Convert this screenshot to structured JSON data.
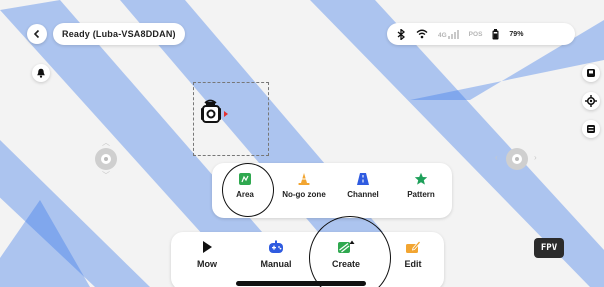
{
  "header": {
    "back_icon": "chevron-left-icon",
    "status": "Ready  (Luba-VSA8DDAN)"
  },
  "connection": {
    "bluetooth_icon": "bluetooth-icon",
    "wifi_icon": "wifi-icon",
    "cellular_label": "4G",
    "rtk_label": "POS",
    "battery_icon": "battery-icon",
    "battery": "79%"
  },
  "left_controls": {
    "alert_icon": "bell-icon"
  },
  "right_controls": {
    "icons": [
      "map-layers-icon",
      "locate-icon",
      "task-list-icon"
    ]
  },
  "create_menu": {
    "items": [
      {
        "label": "Area",
        "icon": "area-icon",
        "color": "#2fa84f"
      },
      {
        "label": "No-go zone",
        "icon": "traffic-cone-icon",
        "color": "#f2a531"
      },
      {
        "label": "Channel",
        "icon": "channel-road-icon",
        "color": "#2f5be0"
      },
      {
        "label": "Pattern",
        "icon": "star-icon",
        "color": "#1ea05a"
      }
    ]
  },
  "bottom_nav": {
    "items": [
      {
        "label": "Mow",
        "icon": "play-icon",
        "color": "#111111"
      },
      {
        "label": "Manual",
        "icon": "gamepad-icon",
        "color": "#2f5be0"
      },
      {
        "label": "Create",
        "icon": "create-map-icon",
        "color": "#2fa84f"
      },
      {
        "label": "Edit",
        "icon": "edit-pencil-icon",
        "color": "#f2a531"
      }
    ]
  },
  "fpv_label": "FPV",
  "colors": {
    "background_stripe": "#2f6fe8",
    "accent_green": "#2fa84f",
    "accent_orange": "#f2a531",
    "accent_blue": "#2f5be0"
  }
}
